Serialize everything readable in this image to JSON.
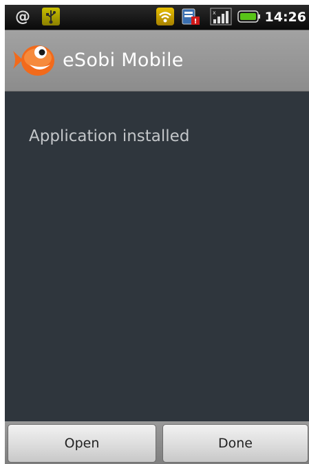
{
  "status_bar": {
    "time": "14:26",
    "icons": [
      "at-sign-icon",
      "usb-icon",
      "wifi-icon",
      "sim-alert-icon",
      "signal-icon",
      "battery-icon"
    ]
  },
  "title_bar": {
    "app_name": "eSobi Mobile",
    "icon": "esobi-fish-logo"
  },
  "content": {
    "message": "Application installed"
  },
  "buttons": {
    "open_label": "Open",
    "done_label": "Done"
  },
  "colors": {
    "title_bar": "#999999",
    "content_bg": "#2f363d",
    "message_text": "#c3c6c9",
    "logo_orange": "#f26a1b"
  }
}
